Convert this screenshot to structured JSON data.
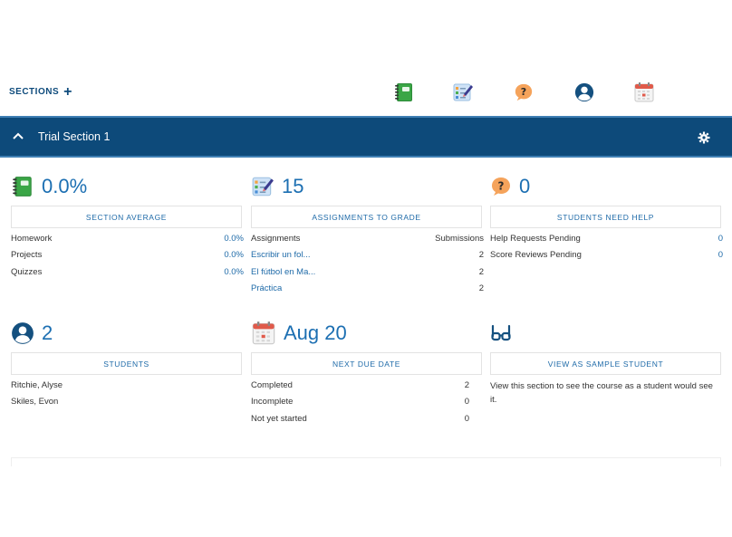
{
  "topbar": {
    "sections_label": "SECTIONS",
    "plus": "+",
    "icons": [
      "gradebook-icon",
      "assignments-to-grade-icon",
      "help-icon",
      "student-icon",
      "calendar-icon"
    ]
  },
  "section": {
    "title": "Trial Section 1",
    "bar_color": "#0d4a7a"
  },
  "average": {
    "value": "0.0%",
    "button": "SECTION AVERAGE",
    "rows": [
      {
        "label": "Homework",
        "value": "0.0%"
      },
      {
        "label": "Projects",
        "value": "0.0%"
      },
      {
        "label": "Quizzes",
        "value": "0.0%"
      }
    ]
  },
  "grading": {
    "value": "15",
    "button": "ASSIGNMENTS TO GRADE",
    "header": {
      "label": "Assignments",
      "value": "Submissions"
    },
    "rows": [
      {
        "label": "Escribir un fol...",
        "value": "2"
      },
      {
        "label": "El fútbol en Ma...",
        "value": "2"
      },
      {
        "label": "Práctica",
        "value": "2"
      }
    ]
  },
  "help": {
    "value": "0",
    "button": "STUDENTS NEED HELP",
    "rows": [
      {
        "label": "Help Requests Pending",
        "value": "0"
      },
      {
        "label": "Score Reviews Pending",
        "value": "0"
      }
    ]
  },
  "students": {
    "value": "2",
    "button": "STUDENTS",
    "rows": [
      {
        "label": "Ritchie, Alyse"
      },
      {
        "label": "Skiles, Evon"
      }
    ]
  },
  "due": {
    "value": "Aug 20",
    "button": "NEXT DUE DATE",
    "rows": [
      {
        "label": "Completed",
        "value": "2"
      },
      {
        "label": "Incomplete",
        "value": "0"
      },
      {
        "label": "Not yet started",
        "value": "0"
      }
    ]
  },
  "sample": {
    "button": "VIEW AS SAMPLE STUDENT",
    "description": "View this section to see the course as a student would see it."
  }
}
